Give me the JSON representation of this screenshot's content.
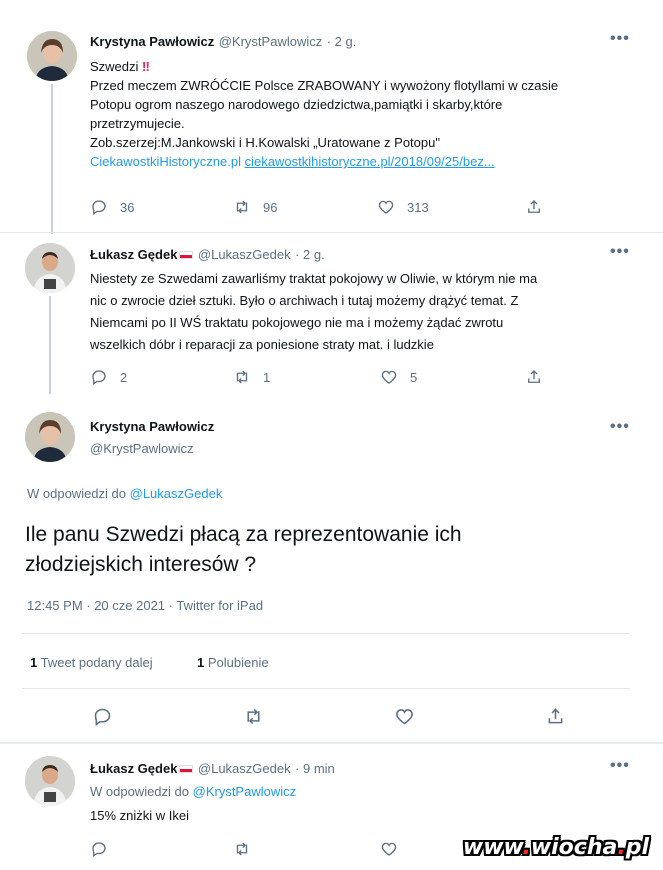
{
  "tweet1": {
    "name": "Krystyna Pawłowicz",
    "handle": "@KrystPawlowicz",
    "time": "· 2 g.",
    "line1": "Szwedzi ",
    "line2": "Przed meczem ZWRÓĆCIE Polsce ZRABOWANY i wywożony flotyllami w czasie",
    "line3": "Potopu ogrom naszego narodowego dziedzictwa,pamiątki i skarby,które",
    "line4": "przetrzymujecie.",
    "line5": "Zob.szerzej:M.Jankowski i H.Kowalski „Uratowane z Potopu\"",
    "link_domain": "CiekawostkiHistoryczne.pl",
    "link_url": "ciekawostkihistoryczne.pl/2018/09/25/bez...",
    "replies": "36",
    "retweets": "96",
    "likes": "313"
  },
  "tweet2": {
    "name": "Łukasz Gędek",
    "handle": "@LukaszGedek",
    "time": "· 2 g.",
    "line1": "Niestety ze Szwedami zawarliśmy traktat pokojowy w Oliwie, w którym nie ma",
    "line2": "nic o zwrocie dzieł sztuki. Było o archiwach i tutaj możemy drążyć temat. Z",
    "line3": "Niemcami po II WŚ traktatu pokojowego nie ma i możemy żądać zwrotu",
    "line4": "wszelkich dóbr i reparacji za poniesione straty mat. i ludzkie",
    "replies": "2",
    "retweets": "1",
    "likes": "5"
  },
  "main": {
    "name": "Krystyna Pawłowicz",
    "handle": "@KrystPawlowicz",
    "reply_prefix": "W odpowiedzi do ",
    "reply_to": "@LukaszGedek",
    "text_line1": "Ile panu Szwedzi płacą za reprezentowanie ich",
    "text_line2": "złodziejskich interesów ?",
    "timestamp": "12:45 PM · 20 cze 2021 · Twitter for iPad",
    "retweets_count": "1",
    "retweets_label": " Tweet podany dalej",
    "likes_count": "1",
    "likes_label": " Polubienie"
  },
  "tweet4": {
    "name": "Łukasz Gędek",
    "handle": "@LukaszGedek",
    "time": "· 9 min",
    "reply_prefix": "W odpowiedzi do ",
    "reply_to": "@KrystPawlowicz",
    "text": "15% zniżki w Ikei"
  },
  "more_label": "•••",
  "watermark": {
    "prefix": "www",
    "dot1": ".",
    "name": "wiocha",
    "dot2": ".",
    "tld": "pl"
  },
  "colors": {
    "accent": "#1d9bf0",
    "muted": "#5b7083",
    "flag_red": "#dc143c",
    "exclaim": "#e0245e"
  }
}
